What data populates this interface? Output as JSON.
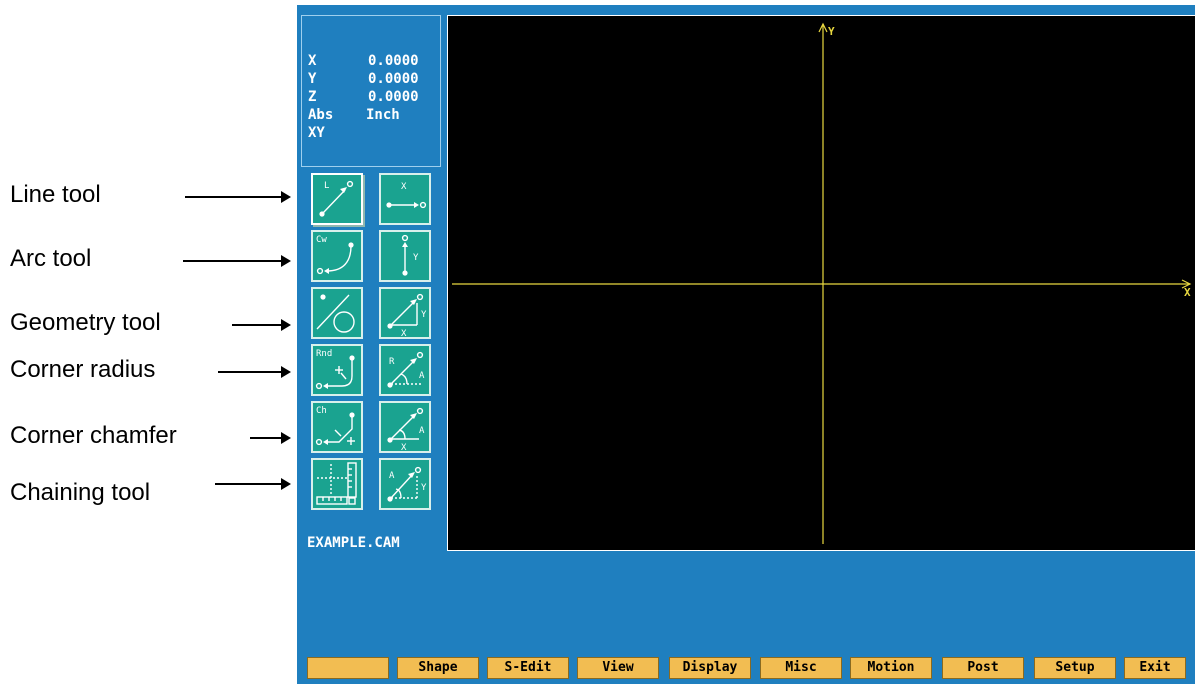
{
  "callouts": [
    {
      "label": "Line tool"
    },
    {
      "label": "Arc tool"
    },
    {
      "label": "Geometry tool"
    },
    {
      "label": "Corner radius"
    },
    {
      "label": "Corner chamfer"
    },
    {
      "label": "Chaining tool"
    }
  ],
  "coords": {
    "x_label": "X",
    "x_value": "0.0000",
    "y_label": "Y",
    "y_value": "0.0000",
    "z_label": "Z",
    "z_value": "0.0000",
    "mode": "Abs",
    "units": "Inch",
    "plane": "XY"
  },
  "tools": {
    "line": {
      "label": "L"
    },
    "arc": {
      "label": "Cw"
    },
    "round": {
      "label": "Rnd"
    },
    "chamfer": {
      "label": "Ch"
    },
    "horizontal": {
      "label": "X"
    },
    "vertical": {
      "label": "Y"
    },
    "delta_x": "X",
    "delta_y": "Y",
    "radius_letter": "R",
    "angle_letter": "A"
  },
  "filename": "EXAMPLE.CAM",
  "canvas": {
    "x_axis_label": "X",
    "y_axis_label": "Y"
  },
  "menu": {
    "blank": "",
    "shape": "Shape",
    "s_edit": "S-Edit",
    "view": "View",
    "display": "Display",
    "misc": "Misc",
    "motion": "Motion",
    "post": "Post",
    "setup": "Setup",
    "exit": "Exit"
  },
  "colors": {
    "app_background": "#1f7fbf",
    "tool_button": "#1aa390",
    "menu_button": "#f2bd52",
    "axis": "#e8d840",
    "canvas": "#000000"
  }
}
